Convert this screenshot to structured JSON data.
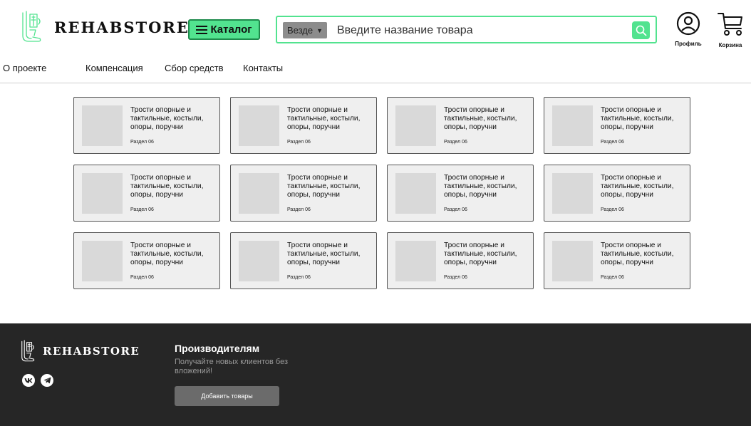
{
  "header": {
    "logo_text": "REHABSTORE",
    "catalog_label": "Каталог",
    "search": {
      "scope": "Везде",
      "placeholder": "Введите название товара"
    },
    "profile_label": "Профиль",
    "cart_label": "Корзина"
  },
  "nav": {
    "items": [
      "О проекте",
      "Компенсация",
      "Сбор средств",
      "Контакты"
    ]
  },
  "products": [
    {
      "title": "Трости опорные и тактильные, костыли, опоры, поручни",
      "section": "Раздел 06"
    },
    {
      "title": "Трости опорные и тактильные, костыли, опоры, поручни",
      "section": "Раздел 06"
    },
    {
      "title": "Трости опорные и тактильные, костыли, опоры, поручни",
      "section": "Раздел 06"
    },
    {
      "title": "Трости опорные и тактильные, костыли, опоры, поручни",
      "section": "Раздел 06"
    },
    {
      "title": "Трости опорные и тактильные, костыли, опоры, поручни",
      "section": "Раздел 06"
    },
    {
      "title": "Трости опорные и тактильные, костыли, опоры, поручни",
      "section": "Раздел 06"
    },
    {
      "title": "Трости опорные и тактильные, костыли, опоры, поручни",
      "section": "Раздел 06"
    },
    {
      "title": "Трости опорные и тактильные, костыли, опоры, поручни",
      "section": "Раздел 06"
    },
    {
      "title": "Трости опорные и тактильные, костыли, опоры, поручни",
      "section": "Раздел 06"
    },
    {
      "title": "Трости опорные и тактильные, костыли, опоры, поручни",
      "section": "Раздел 06"
    },
    {
      "title": "Трости опорные и тактильные, костыли, опоры, поручни",
      "section": "Раздел 06"
    },
    {
      "title": "Трости опорные и тактильные, костыли, опоры, поручни",
      "section": "Раздел 06"
    }
  ],
  "footer": {
    "logo_text": "REHABSTORE",
    "heading": "Производителям",
    "description": "Получайте новых клиентов без вложений!",
    "button_label": "Добавить товары",
    "social_icons": [
      "vk-icon",
      "telegram-icon"
    ]
  },
  "colors": {
    "accent": "#52e38f",
    "accent_border": "#1f8a4c",
    "footer_bg": "#262626",
    "card_bg": "#efefef",
    "footer_button": "#6b6b6b"
  }
}
